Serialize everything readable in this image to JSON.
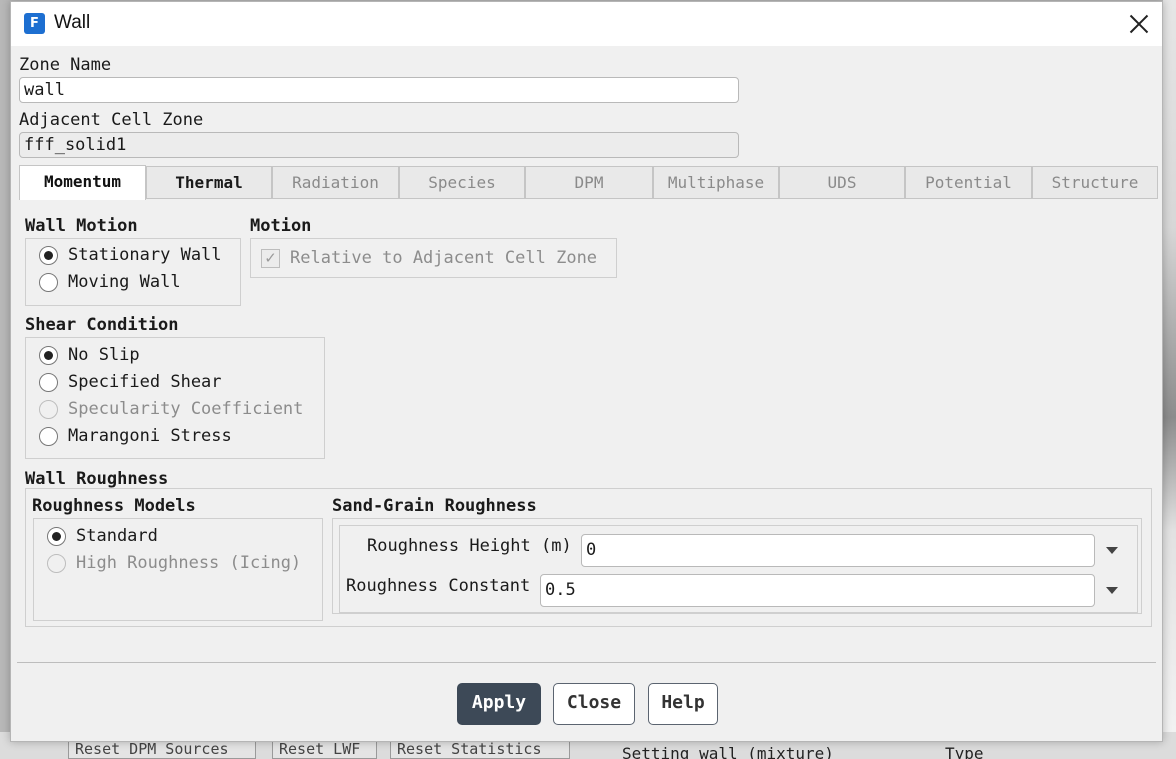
{
  "window": {
    "app_icon_letter": "F",
    "title": "Wall"
  },
  "zone_name": {
    "label": "Zone Name",
    "value": "wall"
  },
  "adjacent_cell_zone": {
    "label": "Adjacent Cell Zone",
    "value": "fff_solid1"
  },
  "tabs": [
    {
      "label": "Momentum",
      "state": "active"
    },
    {
      "label": "Thermal",
      "state": "enabled"
    },
    {
      "label": "Radiation",
      "state": "disabled"
    },
    {
      "label": "Species",
      "state": "disabled"
    },
    {
      "label": "DPM",
      "state": "disabled"
    },
    {
      "label": "Multiphase",
      "state": "disabled"
    },
    {
      "label": "UDS",
      "state": "disabled"
    },
    {
      "label": "Potential",
      "state": "disabled"
    },
    {
      "label": "Structure",
      "state": "disabled"
    }
  ],
  "wall_motion": {
    "heading": "Wall Motion",
    "options": [
      {
        "label": "Stationary Wall",
        "selected": true
      },
      {
        "label": "Moving Wall",
        "selected": false
      }
    ]
  },
  "motion": {
    "heading": "Motion",
    "relative_label": "Relative to Adjacent Cell Zone",
    "relative_checked": true
  },
  "shear_condition": {
    "heading": "Shear Condition",
    "options": [
      {
        "label": "No Slip",
        "selected": true
      },
      {
        "label": "Specified Shear",
        "selected": false
      },
      {
        "label": "Specularity Coefficient",
        "selected": false,
        "disabled": true
      },
      {
        "label": "Marangoni Stress",
        "selected": false
      }
    ]
  },
  "wall_roughness": {
    "heading": "Wall Roughness",
    "models_heading": "Roughness Models",
    "models": [
      {
        "label": "Standard",
        "selected": true
      },
      {
        "label": "High Roughness (Icing)",
        "selected": false,
        "disabled": true
      }
    ],
    "sand_grain_heading": "Sand-Grain Roughness",
    "height_label": "Roughness Height (m)",
    "height_value": "0",
    "constant_label": "Roughness Constant",
    "constant_value": "0.5"
  },
  "buttons": {
    "apply": "Apply",
    "close": "Close",
    "help": "Help"
  },
  "background": {
    "btn1": "Reset DPM Sources",
    "btn2": "Reset LWF",
    "btn3": "Reset Statistics",
    "console_text": "Setting wall (mixture)",
    "right_text": "Type"
  }
}
